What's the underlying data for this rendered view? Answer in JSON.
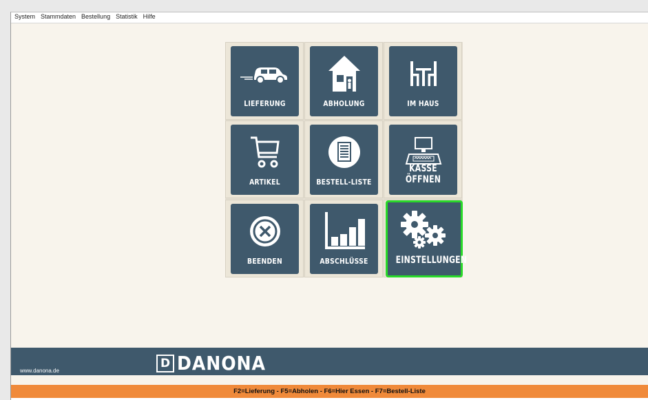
{
  "menu": [
    "System",
    "Stammdaten",
    "Bestellung",
    "Statistik",
    "Hilfe"
  ],
  "tiles": [
    {
      "label": "LIEFERUNG",
      "icon": "car-icon"
    },
    {
      "label": "ABHOLUNG",
      "icon": "house-pickup-icon"
    },
    {
      "label": "IM HAUS",
      "icon": "table-chairs-icon"
    },
    {
      "label": "ARTIKEL",
      "icon": "shopping-cart-icon"
    },
    {
      "label": "BESTELL-LISTE",
      "icon": "document-list-icon"
    },
    {
      "label": "KASSE ÖFFNEN",
      "icon": "cash-register-icon"
    },
    {
      "label": "BEENDEN",
      "icon": "close-circle-icon"
    },
    {
      "label": "ABSCHLÜSSE",
      "icon": "bar-chart-icon"
    },
    {
      "label": "EINSTELLUNGEN",
      "icon": "gears-icon",
      "selected": true
    }
  ],
  "footer": {
    "url": "www.danona.de",
    "logo_letter": "D",
    "logo_text": "DANONA",
    "shortcuts": "F2=Lieferung - F5=Abholen - F6=Hier Essen - F7=Bestell-Liste"
  },
  "colors": {
    "tile_blue": "#3f596c",
    "selection_green": "#29d929",
    "shortcut_bar": "#f08a3a",
    "background": "#f8f4ec"
  }
}
